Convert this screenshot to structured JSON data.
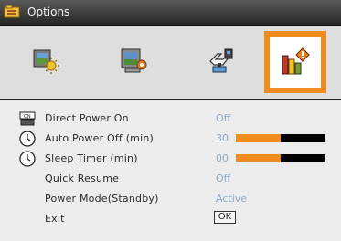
{
  "window": {
    "title": "Options"
  },
  "tabs": [
    {
      "name": "image-tab",
      "icon": "picture-sun-icon"
    },
    {
      "name": "display-tab",
      "icon": "screen-settings-icon"
    },
    {
      "name": "setup-tab",
      "icon": "hand-setup-icon"
    },
    {
      "name": "options-tab",
      "icon": "options-diamond-icon",
      "selected": true
    }
  ],
  "menu": {
    "items": [
      {
        "label": "Direct Power On",
        "value": "Off",
        "icon": "on-switch-icon"
      },
      {
        "label": "Auto Power Off (min)",
        "value": "30",
        "icon": "clock-icon",
        "level_fraction": 0.5
      },
      {
        "label": "Sleep Timer (min)",
        "value": "00",
        "icon": "clock-icon",
        "level_fraction": 0.5
      },
      {
        "label": "Quick Resume",
        "value": "Off"
      },
      {
        "label": "Power Mode(Standby)",
        "value": "Active"
      },
      {
        "label": "Exit",
        "button": "OK"
      }
    ]
  },
  "colors": {
    "accent": "#f08c1e",
    "value_text": "#8aa9cc",
    "bar_background": "#000000"
  }
}
